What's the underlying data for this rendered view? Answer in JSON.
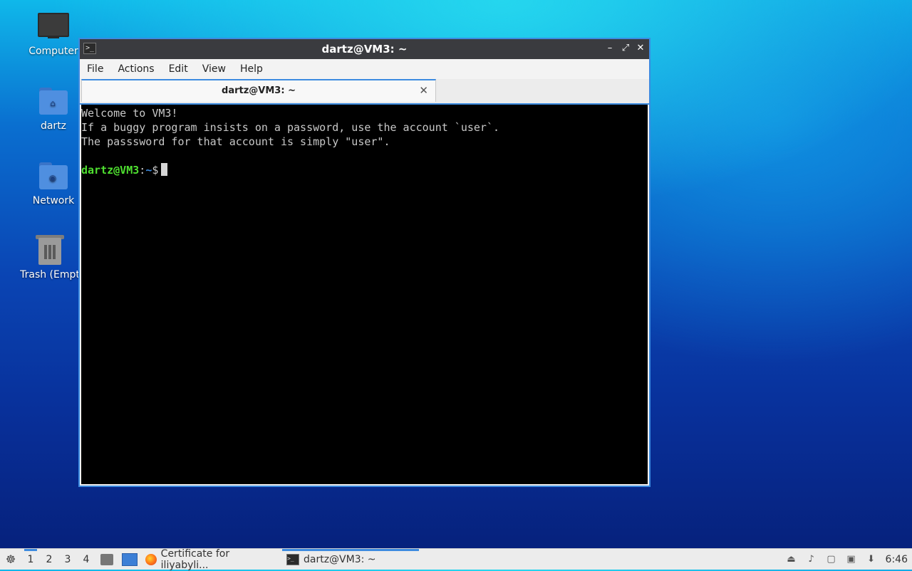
{
  "desktop": {
    "icons": [
      {
        "label": "Computer"
      },
      {
        "label": "dartz"
      },
      {
        "label": "Network"
      },
      {
        "label": "Trash (Empt"
      }
    ]
  },
  "window": {
    "title": "dartz@VM3: ~",
    "controls": {
      "minimize": "–",
      "maximize": "⤢",
      "close": "✕"
    },
    "menu": [
      "File",
      "Actions",
      "Edit",
      "View",
      "Help"
    ],
    "tab": {
      "label": "dartz@VM3: ~",
      "close": "✕"
    },
    "console": {
      "lines": [
        "Welcome to VM3!",
        "If a buggy program insists on a password, use the account `user`.",
        "The passsword for that account is simply \"user\".",
        ""
      ],
      "prompt_user": "dartz@VM3",
      "prompt_sep": ":",
      "prompt_path": "~",
      "prompt_symbol": "$"
    }
  },
  "taskbar": {
    "start_glyph": "☸",
    "workspaces": [
      "1",
      "2",
      "3",
      "4"
    ],
    "active_workspace": "1",
    "tasks": [
      {
        "label": "Certificate for iliyabyli...",
        "icon": "firefox-icon"
      },
      {
        "label": "dartz@VM3: ~",
        "icon": "terminal-icon",
        "active": true
      }
    ],
    "clock": "6:46"
  },
  "colors": {
    "accent": "#3c8be0",
    "prompt_user": "#4fe030",
    "terminal_bg": "#000000"
  }
}
